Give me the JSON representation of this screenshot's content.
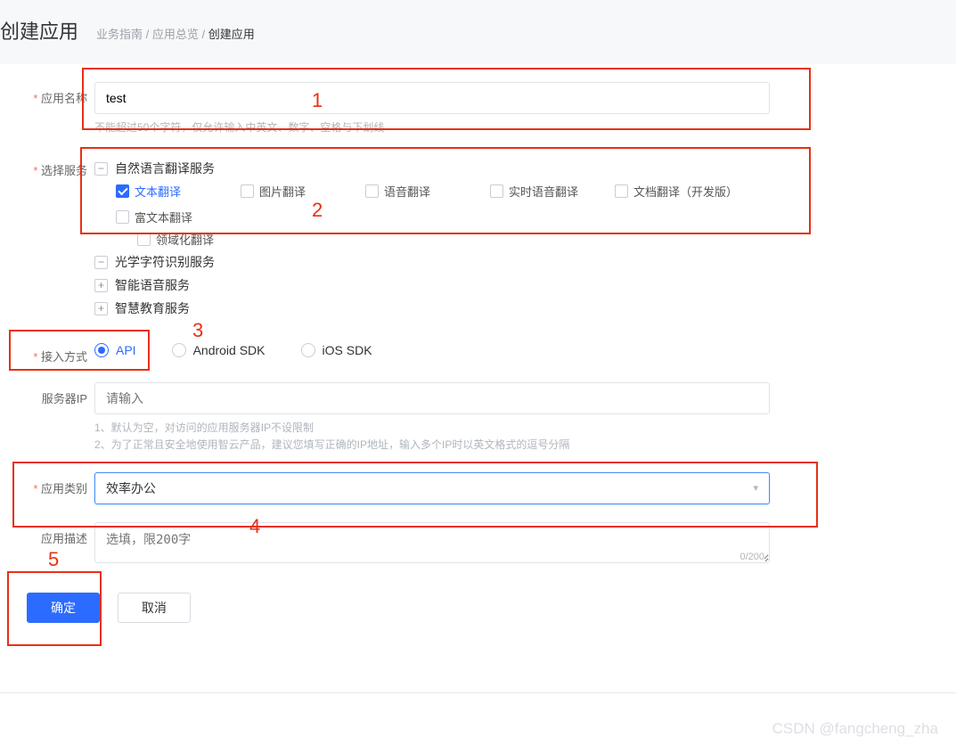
{
  "header": {
    "title": "创建应用",
    "breadcrumb": {
      "item1": "业务指南",
      "item2": "应用总览",
      "current": "创建应用"
    }
  },
  "app_name": {
    "label": "应用名称",
    "value": "test",
    "hint": "不能超过50个字符，仅允许输入中英文、数字、空格与下划线"
  },
  "select_service": {
    "label": "选择服务",
    "group1": {
      "name": "自然语言翻译服务",
      "options": [
        {
          "label": "文本翻译",
          "checked": true,
          "active": true
        },
        {
          "label": "图片翻译",
          "checked": false
        },
        {
          "label": "语音翻译",
          "checked": false
        },
        {
          "label": "实时语音翻译",
          "checked": false
        },
        {
          "label": "文档翻译（开发版）",
          "checked": false,
          "wide": true
        },
        {
          "label": "富文本翻译",
          "checked": false
        }
      ],
      "sub2": {
        "label": "领域化翻译",
        "checked": false
      }
    },
    "group2": {
      "name": "光学字符识别服务"
    },
    "group3": {
      "name": "智能语音服务"
    },
    "group4": {
      "name": "智慧教育服务"
    }
  },
  "access_method": {
    "label": "接入方式",
    "options": [
      {
        "label": "API",
        "checked": true
      },
      {
        "label": "Android SDK",
        "checked": false
      },
      {
        "label": "iOS SDK",
        "checked": false
      }
    ]
  },
  "server_ip": {
    "label": "服务器IP",
    "placeholder": "请输入",
    "hint1": "1、默认为空，对访问的应用服务器IP不设限制",
    "hint2": "2、为了正常且安全地使用智云产品，建议您填写正确的IP地址，输入多个IP时以英文格式的逗号分隔"
  },
  "app_category": {
    "label": "应用类别",
    "value": "效率办公"
  },
  "app_desc": {
    "label": "应用描述",
    "placeholder": "选填，限200字",
    "counter": "0/200"
  },
  "buttons": {
    "ok": "确定",
    "cancel": "取消"
  },
  "annotations": {
    "n1": "1",
    "n2": "2",
    "n3": "3",
    "n4": "4",
    "n5": "5"
  },
  "watermark": "CSDN @fangcheng_zha"
}
